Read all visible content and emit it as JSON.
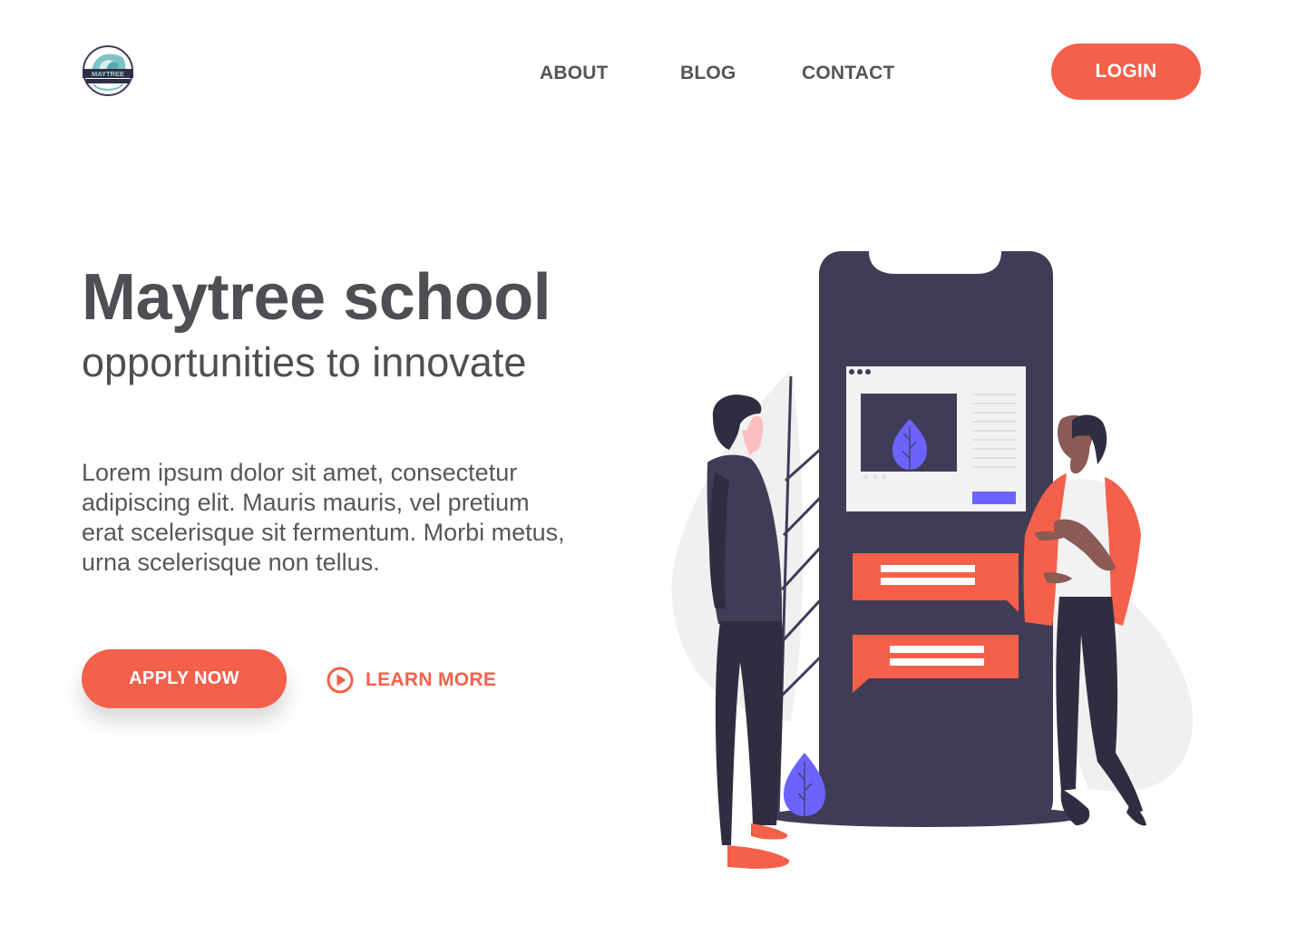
{
  "logo": {
    "icon": "maytree-logo-icon",
    "text": "MAYTREE"
  },
  "nav": {
    "items": [
      {
        "label": "ABOUT"
      },
      {
        "label": "BLOG"
      },
      {
        "label": "CONTACT"
      }
    ],
    "login_label": "LOGIN"
  },
  "hero": {
    "title": "Maytree school",
    "subtitle": "opportunities to innovate",
    "body": "Lorem ipsum dolor sit amet, consectetur adipiscing elit. Mauris mauris, vel pretium erat scelerisque sit fermentum. Morbi metus, urna scelerisque non tellus.",
    "apply_label": "APPLY NOW",
    "learn_more_label": "LEARN MORE",
    "learn_more_icon": "play-circle-icon"
  },
  "colors": {
    "accent": "#f4604a",
    "text_dark": "#4f4e53",
    "phone": "#3f3d56",
    "leaf": "#6c63ff"
  }
}
